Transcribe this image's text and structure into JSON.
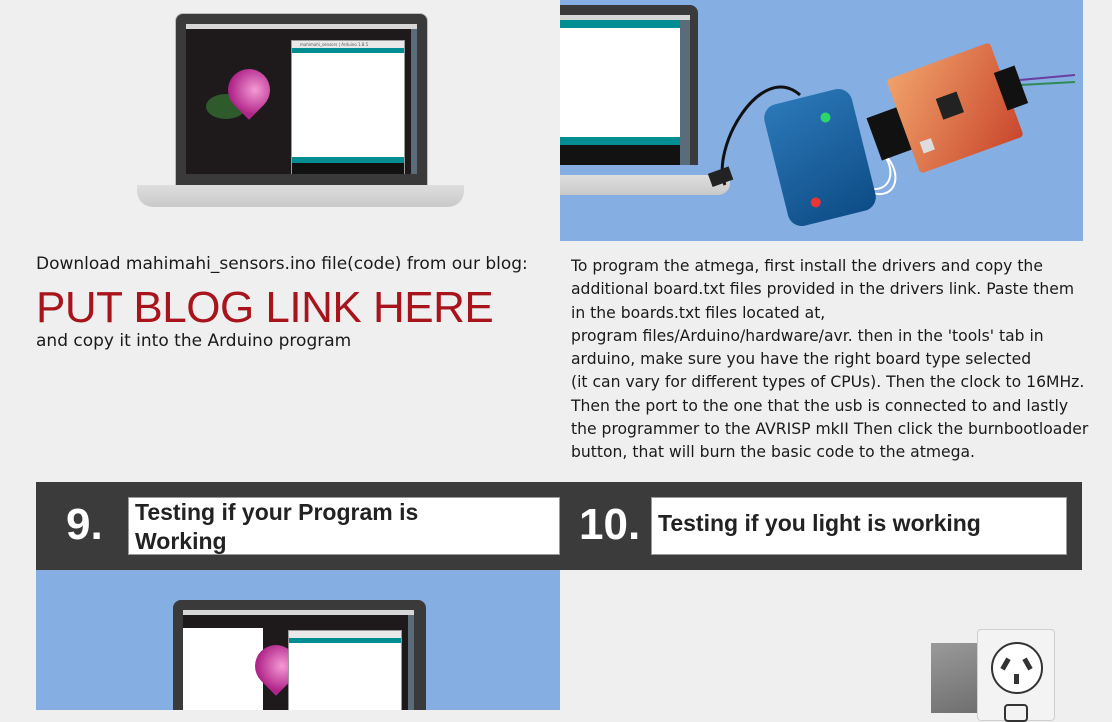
{
  "left_section": {
    "download_text": "Download mahimahi_sensors.ino file(code) from our blog:",
    "blog_link": "PUT BLOG LINK HERE",
    "copy_text": "and copy it into the Arduino program"
  },
  "right_section": {
    "instructions": [
      "To program the atmega, first install the drivers and copy the",
      "additional board.txt files provided in the drivers link. Paste them",
      "in the boards.txt files located at,",
      "program files/Arduino/hardware/avr. then in the 'tools' tab in",
      "arduino, make sure you have the right board type selected",
      "(it can vary for different types of CPUs). Then the clock to 16MHz.",
      "Then the port to the one that the usb is connected to and lastly",
      "the programmer to the AVRISP mkII Then click the burnbootloader",
      "button, that will burn the basic code to the atmega."
    ]
  },
  "steps": [
    {
      "number": "9.",
      "title_lines": [
        "Testing if your Program is",
        "Working"
      ]
    },
    {
      "number": "10.",
      "title_lines": [
        "Testing if you light is working"
      ]
    }
  ],
  "arduino_window": {
    "title": "mahimahi_sensors | Arduino 1.8.5"
  },
  "colors": {
    "link_red": "#a8141b",
    "panel_blue": "#85aee2",
    "band_dark": "#3b3b3b",
    "arduino_teal": "#008e92"
  },
  "icons": [
    "laptop-illustration",
    "usb-programmer-illustration",
    "circuit-board-illustration",
    "power-outlet-illustration"
  ]
}
